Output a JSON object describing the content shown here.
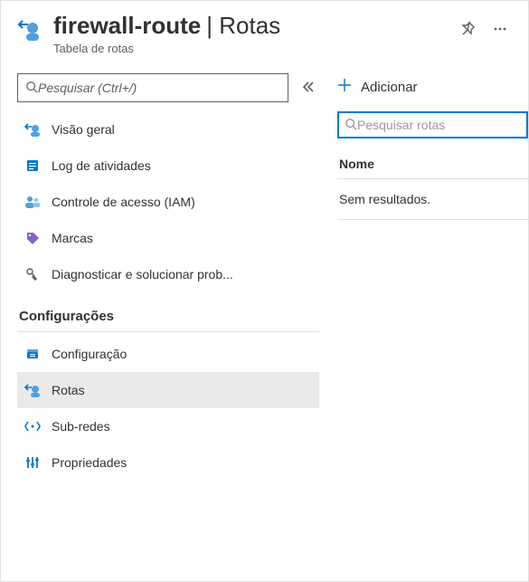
{
  "header": {
    "title": "firewall-route",
    "section": "Rotas",
    "subtitle": "Tabela de rotas"
  },
  "sidebar": {
    "search_placeholder": "Pesquisar (Ctrl+/)",
    "items": [
      {
        "label": "Visão geral",
        "icon": "overview"
      },
      {
        "label": "Log de atividades",
        "icon": "activity-log"
      },
      {
        "label": "Controle de acesso (IAM)",
        "icon": "access"
      },
      {
        "label": "Marcas",
        "icon": "tags"
      },
      {
        "label": "Diagnosticar e solucionar prob...",
        "icon": "diagnose"
      }
    ],
    "settings_header": "Configurações",
    "settings_items": [
      {
        "label": "Configuração",
        "icon": "config"
      },
      {
        "label": "Rotas",
        "icon": "routes",
        "selected": true
      },
      {
        "label": "Sub-redes",
        "icon": "subnets"
      },
      {
        "label": "Propriedades",
        "icon": "properties"
      }
    ]
  },
  "main": {
    "add_label": "Adicionar",
    "filter_placeholder": "Pesquisar rotas",
    "column_header": "Nome",
    "empty_text": "Sem resultados."
  }
}
